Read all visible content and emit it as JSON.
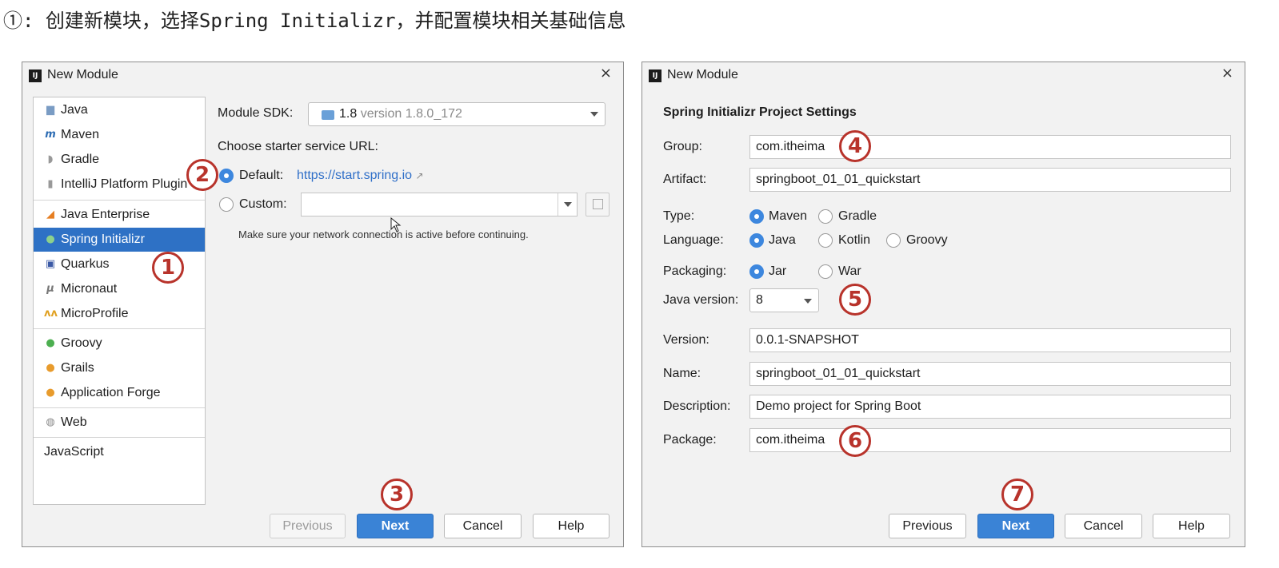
{
  "caption": "①: 创建新模块，选择Spring Initializr，并配置模块相关基础信息",
  "left_dialog": {
    "title": "New Module",
    "app_icon": "IJ",
    "sidebar": [
      {
        "label": "Java",
        "icon": "folder-icon",
        "selected": false
      },
      {
        "label": "Maven",
        "icon": "maven-icon",
        "selected": false
      },
      {
        "label": "Gradle",
        "icon": "gradle-icon",
        "selected": false
      },
      {
        "label": "IntelliJ Platform Plugin",
        "icon": "plugin-icon",
        "selected": false
      },
      {
        "label": "Java Enterprise",
        "icon": "java-enterprise-icon",
        "selected": false
      },
      {
        "label": "Spring Initializr",
        "icon": "spring-icon",
        "selected": true
      },
      {
        "label": "Quarkus",
        "icon": "quarkus-icon",
        "selected": false
      },
      {
        "label": "Micronaut",
        "icon": "micronaut-icon",
        "selected": false
      },
      {
        "label": "MicroProfile",
        "icon": "microprofile-icon",
        "selected": false
      },
      {
        "label": "Groovy",
        "icon": "groovy-icon",
        "selected": false
      },
      {
        "label": "Grails",
        "icon": "grails-icon",
        "selected": false
      },
      {
        "label": "Application Forge",
        "icon": "forge-icon",
        "selected": false
      },
      {
        "label": "Web",
        "icon": "globe-icon",
        "selected": false
      },
      {
        "label": "JavaScript",
        "icon": "",
        "selected": false
      }
    ],
    "module_sdk_label": "Module SDK:",
    "sdk_value": "1.8",
    "sdk_version": "version 1.8.0_172",
    "starter_url_label": "Choose starter service URL:",
    "default_label": "Default:",
    "default_url": "https://start.spring.io",
    "default_selected": true,
    "custom_label": "Custom:",
    "custom_value": "",
    "network_hint": "Make sure your network connection is active before continuing.",
    "buttons": {
      "previous": "Previous",
      "next": "Next",
      "cancel": "Cancel",
      "help": "Help"
    }
  },
  "right_dialog": {
    "title": "New Module",
    "app_icon": "IJ",
    "section_title": "Spring Initializr Project Settings",
    "group_label": "Group:",
    "group_value": "com.itheima",
    "artifact_label": "Artifact:",
    "artifact_value": "springboot_01_01_quickstart",
    "type_label": "Type:",
    "type_options": [
      "Maven",
      "Gradle"
    ],
    "type_selected": "Maven",
    "language_label": "Language:",
    "language_options": [
      "Java",
      "Kotlin",
      "Groovy"
    ],
    "language_selected": "Java",
    "packaging_label": "Packaging:",
    "packaging_options": [
      "Jar",
      "War"
    ],
    "packaging_selected": "Jar",
    "java_version_label": "Java version:",
    "java_version_value": "8",
    "version_label": "Version:",
    "version_value": "0.0.1-SNAPSHOT",
    "name_label": "Name:",
    "name_value": "springboot_01_01_quickstart",
    "description_label": "Description:",
    "description_value": "Demo project for Spring Boot",
    "package_label": "Package:",
    "package_value": "com.itheima",
    "buttons": {
      "previous": "Previous",
      "next": "Next",
      "cancel": "Cancel",
      "help": "Help"
    }
  },
  "annotations": [
    "1",
    "2",
    "3",
    "4",
    "5",
    "6",
    "7"
  ],
  "colors": {
    "accent": "#2e71c5",
    "primary_button": "#3a83d6",
    "badge": "#b8332b",
    "link": "#2f6fc8"
  }
}
